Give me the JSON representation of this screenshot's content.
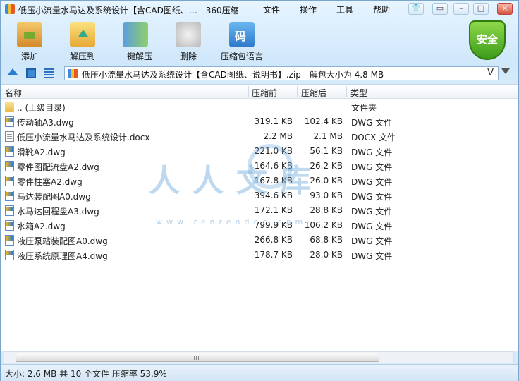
{
  "window": {
    "title": "低压小流量水马达及系统设计【含CAD图纸、… - 360压缩",
    "menu": [
      "文件",
      "操作",
      "工具",
      "帮助"
    ]
  },
  "toolbar": {
    "buttons": [
      {
        "label": "添加",
        "icon": "add-archive-icon"
      },
      {
        "label": "解压到",
        "icon": "extract-to-icon"
      },
      {
        "label": "一键解压",
        "icon": "one-click-extract-icon"
      },
      {
        "label": "删除",
        "icon": "delete-icon"
      },
      {
        "label": "压缩包语言",
        "icon": "archive-language-icon"
      }
    ],
    "security_badge": "安全"
  },
  "address": {
    "text": "低压小流量水马达及系统设计【含CAD图纸、说明书】.zip - 解包大小为 4.8 MB",
    "v_mark": "V"
  },
  "columns": {
    "name": "名称",
    "compressed": "压缩前",
    "original": "压缩后",
    "type": "类型"
  },
  "files": [
    {
      "name": ".. (上级目录)",
      "compressed": "",
      "original": "",
      "type": "文件夹",
      "icon": "folder"
    },
    {
      "name": "传动轴A3.dwg",
      "compressed": "319.1 KB",
      "original": "102.4 KB",
      "type": "DWG 文件",
      "icon": "dwg"
    },
    {
      "name": "低压小流量水马达及系统设计.docx",
      "compressed": "2.2 MB",
      "original": "2.1 MB",
      "type": "DOCX 文件",
      "icon": "doc"
    },
    {
      "name": "滑靴A2.dwg",
      "compressed": "221.0 KB",
      "original": "56.1 KB",
      "type": "DWG 文件",
      "icon": "dwg"
    },
    {
      "name": "零件图配流盘A2.dwg",
      "compressed": "164.6 KB",
      "original": "26.2 KB",
      "type": "DWG 文件",
      "icon": "dwg"
    },
    {
      "name": "零件柱塞A2.dwg",
      "compressed": "167.8 KB",
      "original": "26.0 KB",
      "type": "DWG 文件",
      "icon": "dwg"
    },
    {
      "name": "马达装配图A0.dwg",
      "compressed": "394.6 KB",
      "original": "93.0 KB",
      "type": "DWG 文件",
      "icon": "dwg"
    },
    {
      "name": "水马达回程盘A3.dwg",
      "compressed": "172.1 KB",
      "original": "28.8 KB",
      "type": "DWG 文件",
      "icon": "dwg"
    },
    {
      "name": "水箱A2.dwg",
      "compressed": "799.9 KB",
      "original": "106.2 KB",
      "type": "DWG 文件",
      "icon": "dwg"
    },
    {
      "name": "液压泵站装配图A0.dwg",
      "compressed": "266.8 KB",
      "original": "68.8 KB",
      "type": "DWG 文件",
      "icon": "dwg"
    },
    {
      "name": "液压系统原理图A4.dwg",
      "compressed": "178.7 KB",
      "original": "28.0 KB",
      "type": "DWG 文件",
      "icon": "dwg"
    }
  ],
  "watermark": {
    "text": "人人文库",
    "url": "www.renrendoc.com"
  },
  "status": "大小: 2.6 MB 共 10 个文件 压缩率 53.9%"
}
